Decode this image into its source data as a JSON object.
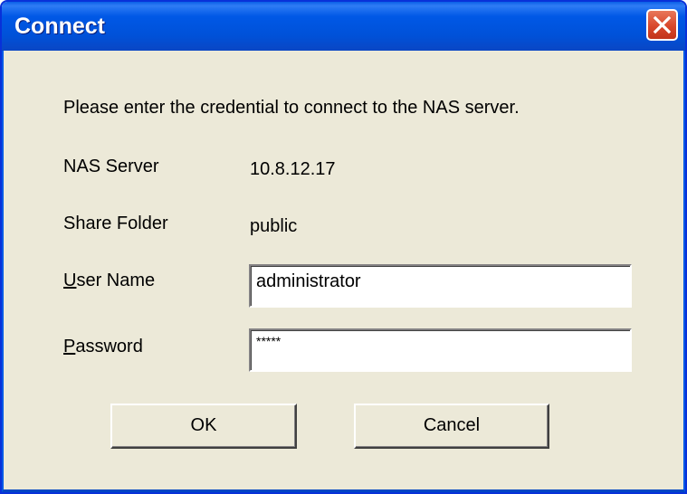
{
  "window": {
    "title": "Connect",
    "close_label": "Close"
  },
  "message": "Please enter the credential to connect to the NAS server.",
  "nas_server": {
    "label": "NAS Server",
    "value": "10.8.12.17"
  },
  "share_folder": {
    "label": "Share Folder",
    "value": "public"
  },
  "user_name": {
    "label_accel": "U",
    "label_rest": "ser Name",
    "value": "administrator"
  },
  "password": {
    "label_accel": "P",
    "label_rest": "assword",
    "value": "*****"
  },
  "buttons": {
    "ok": "OK",
    "cancel": "Cancel"
  },
  "colors": {
    "titlebar": "#0058e6",
    "dialog_bg": "#ece9d8",
    "close_button": "#d9472b"
  }
}
